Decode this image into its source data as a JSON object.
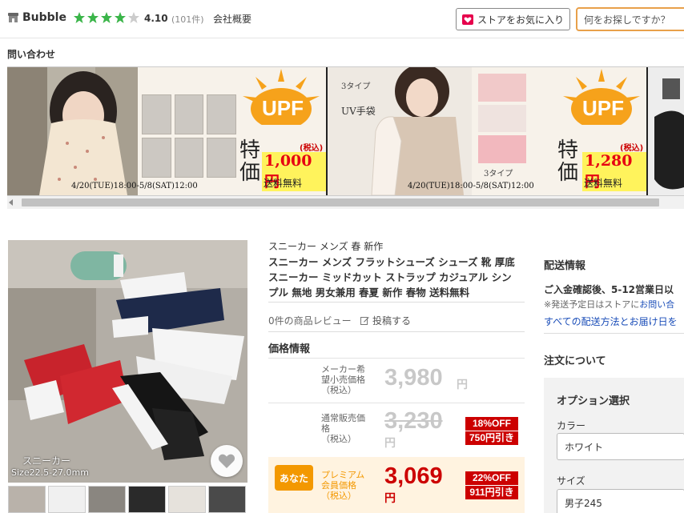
{
  "header": {
    "store_name": "Bubble",
    "rating": "4.10",
    "rating_value": 4.1,
    "review_count": "(101件)",
    "about_link": "会社概要",
    "favorite_button": "ストアをお気に入り",
    "search_placeholder": "何をお探しですか？"
  },
  "inquiry_link": "問い合わせ",
  "banners": [
    {
      "upf": "UPF",
      "special": "特\n価",
      "tax": "(税込)",
      "price": "1,000 円",
      "shipping": "送料無料",
      "date": "4/20(TUE)18:00-5/8(SAT)12:00"
    },
    {
      "upf": "UPF",
      "special": "特\n価",
      "tax": "(税込)",
      "price": "1,280 円",
      "shipping": "送料無料",
      "date": "4/20(TUE)18:00-5/8(SAT)12:00",
      "tag1": "3タイプ",
      "tag2": "UV手袋",
      "tag3": "3タイプ"
    }
  ],
  "product": {
    "image_caption": "スニーカー",
    "image_caption2": "Size22.5-27.0mm",
    "breadcrumb": "スニーカー メンズ 春 新作",
    "title": "スニーカー メンズ フラットシューズ シューズ 靴 厚底スニーカー ミッドカット ストラップ カジュアル シンプル 無地 男女兼用 春夏 新作 春物 送料無料",
    "review_count": "0件の商品レビュー",
    "post_review": "投稿する"
  },
  "pricing": {
    "heading": "価格情報",
    "maker_label": "メーカー希\n望小売価格\n（税込）",
    "maker_price": "3,980",
    "maker_yen": "円",
    "regular_label": "通常販売価\n格\n（税込）",
    "regular_price": "3,230",
    "regular_yen": "円",
    "regular_off": "18%OFF",
    "regular_discount": "750円引き",
    "premium_badge": "あなた",
    "premium_label": "プレミアム\n会員価格\n（税込）",
    "premium_price": "3,069",
    "premium_yen": "円",
    "premium_off": "22%OFF",
    "premium_discount": "911円引き"
  },
  "shipping": {
    "heading": "配送情報",
    "days": "ご入金確認後、5-12営業日以",
    "note_prefix": "※発送予定日はストアに",
    "note_link": "お問い合",
    "all_methods_link": "すべての配送方法とお届け日を"
  },
  "order": {
    "heading": "注文について",
    "option_title": "オプション選択",
    "color_label": "カラー",
    "color_value": "ホワイト",
    "size_label": "サイズ",
    "size_value": "男子245"
  },
  "colors": {
    "accent_orange": "#f39800",
    "sale_red": "#cc0000",
    "star_green": "#3bb54a",
    "link_blue": "#1a4db8"
  }
}
